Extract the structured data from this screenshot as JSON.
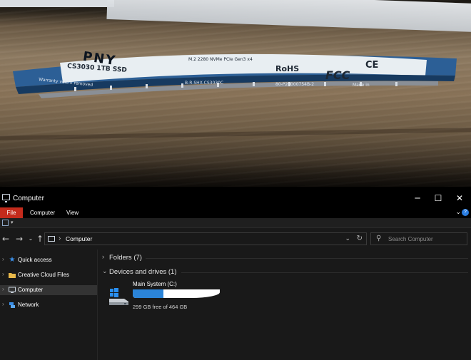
{
  "photo": {
    "ssd_label": {
      "brand": "PNY",
      "model": "CS3030 1TB SSD",
      "spec": "M.2 2280 NVMe PCIe Gen3 x4",
      "rohs": "RoHS",
      "fcc": "FCC",
      "ce": "CE",
      "serial": "B-R-SHX-CS3030C",
      "part": "80-P20000754B-2",
      "made": "Made in",
      "warning": "Warranty void if removed"
    }
  },
  "window": {
    "title": "Computer",
    "controls": {
      "minimize": "─",
      "maximize": "☐",
      "close": "✕"
    },
    "ribbon": {
      "tabs": [
        "File",
        "Computer",
        "View"
      ],
      "collapse_glyph": "⌄",
      "help_glyph": "?"
    },
    "address": {
      "crumb": "Computer",
      "separator": "›"
    },
    "search": {
      "placeholder": "Search Computer"
    },
    "nav": {
      "items": [
        {
          "label": "Quick access",
          "icon": "star-icon"
        },
        {
          "label": "Creative Cloud Files",
          "icon": "folder-icon"
        },
        {
          "label": "Computer",
          "icon": "computer-icon"
        },
        {
          "label": "Network",
          "icon": "network-icon"
        }
      ],
      "selected": "Computer"
    },
    "groups": {
      "folders": "Folders (7)",
      "devices": "Devices and drives (1)"
    },
    "drive": {
      "name": "Main System (C:)",
      "free_text": "299 GB free of 464 GB",
      "used_fraction": 0.356,
      "bar_color": "#2b84d8"
    },
    "colors": {
      "file_tab": "#c42b1c",
      "accent": "#2a7de1",
      "background": "#191919"
    }
  }
}
